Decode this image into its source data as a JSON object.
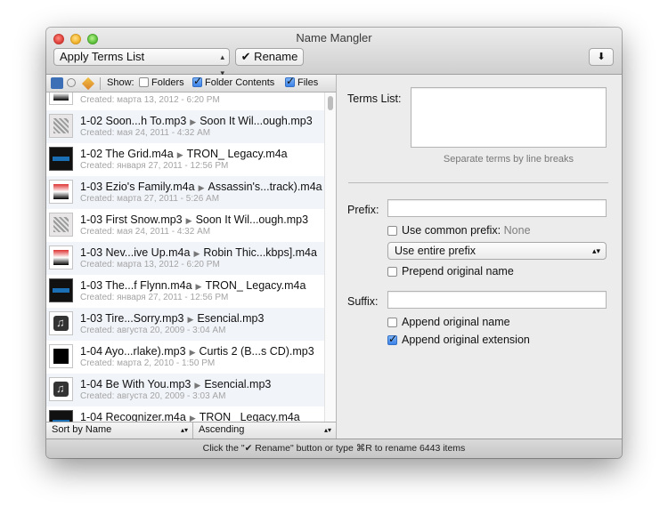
{
  "window": {
    "title": "Name Mangler"
  },
  "toolbar": {
    "mode_select": "Apply Terms List",
    "rename_label": "✔ Rename",
    "export_icon": "down-arrow-icon"
  },
  "filter_bar": {
    "show_label": "Show:",
    "options": [
      {
        "label": "Folders",
        "checked": false
      },
      {
        "label": "Folder Contents",
        "checked": true
      },
      {
        "label": "Files",
        "checked": true
      }
    ]
  },
  "files": [
    {
      "original": "",
      "new": "",
      "created": "Created: марта 13, 2012 - 6:20 PM",
      "thumb": "col"
    },
    {
      "original": "1-02 Soon...h To.mp3",
      "new": "Soon It Wil...ough.mp3",
      "created": "Created: мая 24, 2011 - 4:32 AM",
      "thumb": "gray"
    },
    {
      "original": "1-02 The Grid.m4a",
      "new": "TRON_ Legacy.m4a",
      "created": "Created: января 27, 2011 - 12:56 PM",
      "thumb": "dark"
    },
    {
      "original": "1-03 Ezio's Family.m4a",
      "new": "Assassin's...track).m4a",
      "created": "Created: марта 27, 2011 - 5:26 AM",
      "thumb": "col"
    },
    {
      "original": "1-03 First Snow.mp3",
      "new": "Soon It Wil...ough.mp3",
      "created": "Created: мая 24, 2011 - 4:32 AM",
      "thumb": "gray"
    },
    {
      "original": "1-03 Nev...ive Up.m4a",
      "new": "Robin Thic...kbps].m4a",
      "created": "Created: марта 13, 2012 - 6:20 PM",
      "thumb": "col"
    },
    {
      "original": "1-03 The...f Flynn.m4a",
      "new": "TRON_ Legacy.m4a",
      "created": "Created: января 27, 2011 - 12:56 PM",
      "thumb": "dark"
    },
    {
      "original": "1-03 Tire...Sorry.mp3",
      "new": "Esencial.mp3",
      "created": "Created: августа 20, 2009 - 3:04 AM",
      "thumb": "note"
    },
    {
      "original": "1-04 Ayo...rlake).mp3",
      "new": "Curtis 2 (B...s CD).mp3",
      "created": "Created: марта 2, 2010 - 1:50 PM",
      "thumb": "bw"
    },
    {
      "original": "1-04 Be With You.mp3",
      "new": "Esencial.mp3",
      "created": "Created: августа 20, 2009 - 3:03 AM",
      "thumb": "note"
    },
    {
      "original": "1-04 Recognizer.m4a",
      "new": "TRON_ Legacy.m4a",
      "created": "",
      "thumb": "dark"
    }
  ],
  "sort": {
    "by": "Sort by Name",
    "order": "Ascending"
  },
  "right": {
    "terms_list_label": "Terms List:",
    "terms_list_value": "",
    "terms_hint": "Separate terms by line breaks",
    "prefix_label": "Prefix:",
    "prefix_value": "",
    "use_common_prefix_label": "Use common prefix:",
    "use_common_prefix_value": "None",
    "use_common_prefix_checked": false,
    "prefix_mode_select": "Use entire prefix",
    "prepend_original_label": "Prepend original name",
    "prepend_original_checked": false,
    "suffix_label": "Suffix:",
    "suffix_value": "",
    "append_original_label": "Append original name",
    "append_original_checked": false,
    "append_extension_label": "Append original extension",
    "append_extension_checked": true
  },
  "status": {
    "text": "Click the \"✔ Rename\" button or type ⌘R to rename 6443 items"
  }
}
